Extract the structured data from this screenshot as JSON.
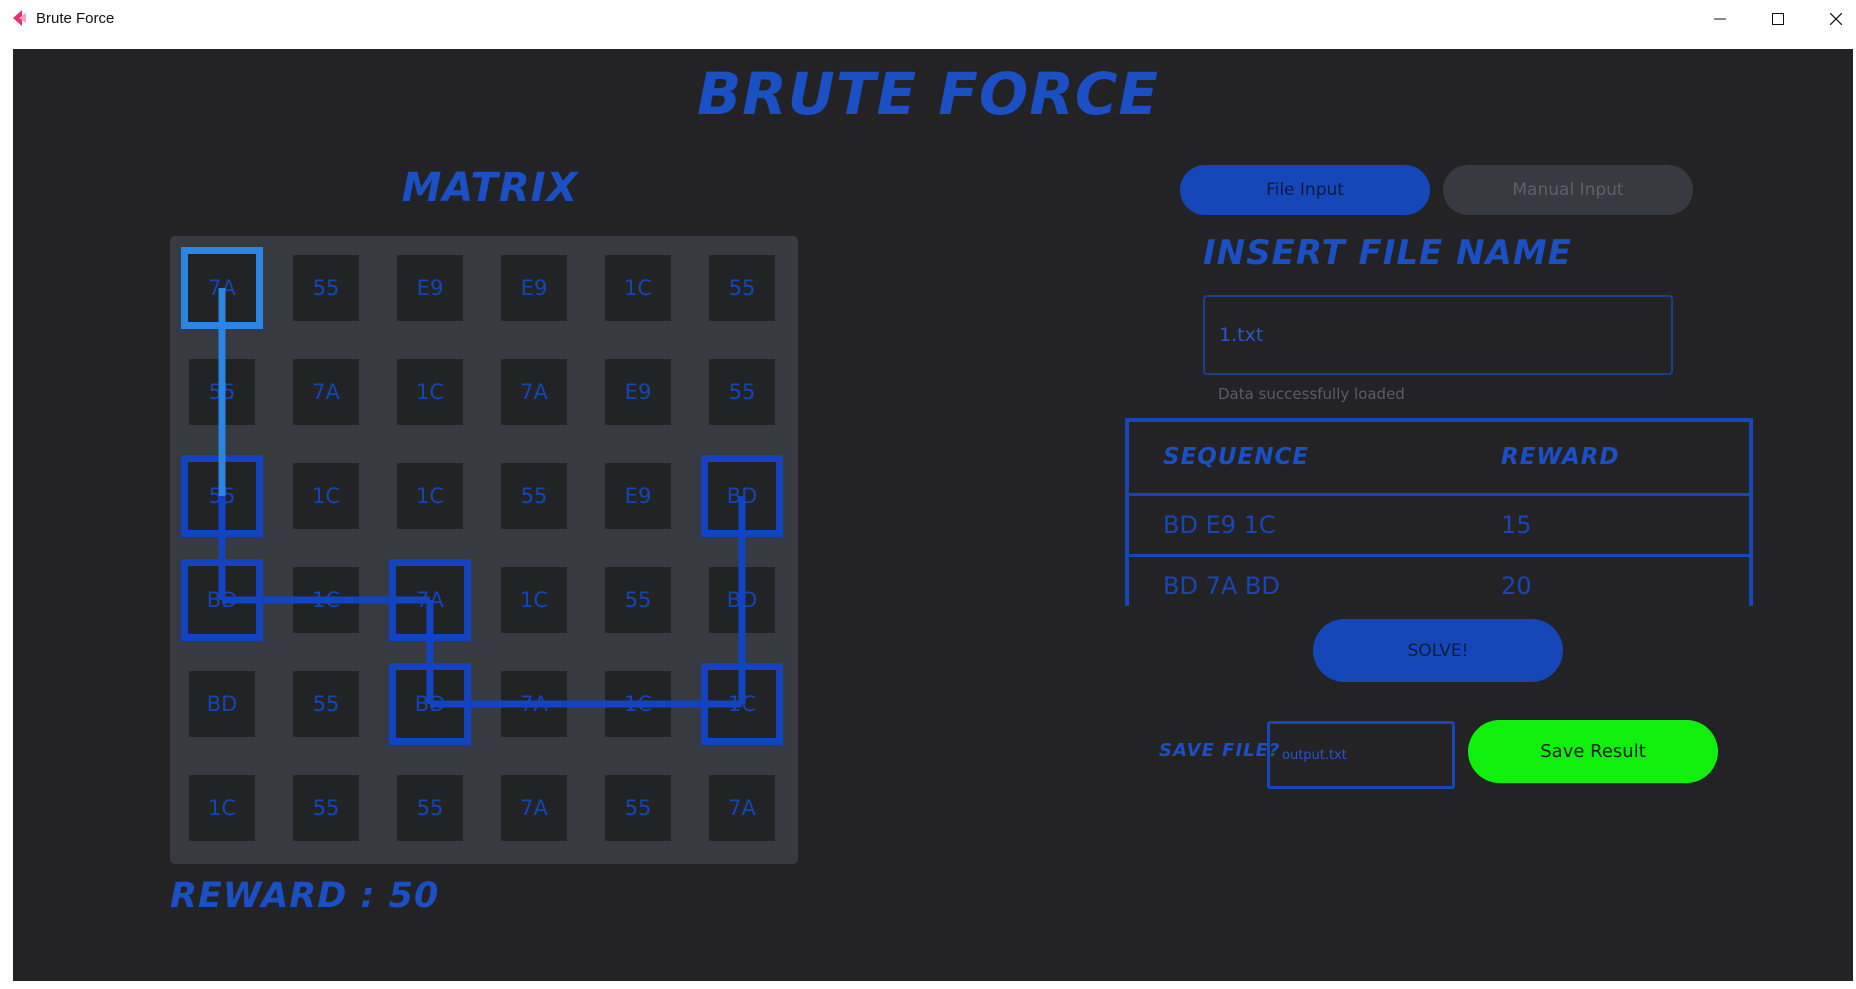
{
  "window": {
    "title": "Brute Force"
  },
  "app": {
    "title": "BRUTE FORCE"
  },
  "matrix": {
    "title": "MATRIX",
    "rows": [
      [
        "7A",
        "55",
        "E9",
        "E9",
        "1C",
        "55"
      ],
      [
        "55",
        "7A",
        "1C",
        "7A",
        "E9",
        "55"
      ],
      [
        "55",
        "1C",
        "1C",
        "55",
        "E9",
        "BD"
      ],
      [
        "BD",
        "1C",
        "7A",
        "1C",
        "55",
        "BD"
      ],
      [
        "BD",
        "55",
        "BD",
        "7A",
        "1C",
        "1C"
      ],
      [
        "1C",
        "55",
        "55",
        "7A",
        "55",
        "7A"
      ]
    ],
    "path": [
      [
        0,
        0
      ],
      [
        2,
        0
      ],
      [
        3,
        0
      ],
      [
        3,
        2
      ],
      [
        4,
        2
      ],
      [
        4,
        5
      ],
      [
        2,
        5
      ]
    ],
    "path_color": "#1244c2",
    "start_color": "#2a86e2"
  },
  "reward": {
    "label": "REWARD : 50"
  },
  "tabs": [
    {
      "label": "File Input"
    },
    {
      "label": "Manual Input"
    }
  ],
  "file_section": {
    "title": "INSERT FILE NAME",
    "value": "1.txt",
    "status": "Data successfully loaded"
  },
  "sequence_table": {
    "headers": [
      "SEQUENCE",
      "REWARD"
    ],
    "rows": [
      {
        "sequence": "BD E9 1C",
        "reward": "15"
      },
      {
        "sequence": "BD 7A BD",
        "reward": "20"
      }
    ]
  },
  "solve_label": "SOLVE!",
  "save": {
    "label": "SAVE FILE?",
    "placeholder": "output.txt",
    "button_label": "Save Result"
  },
  "colors": {
    "accent": "#1547b9",
    "save": "#10f00c",
    "background": "#232325",
    "panel": "#373a40"
  }
}
